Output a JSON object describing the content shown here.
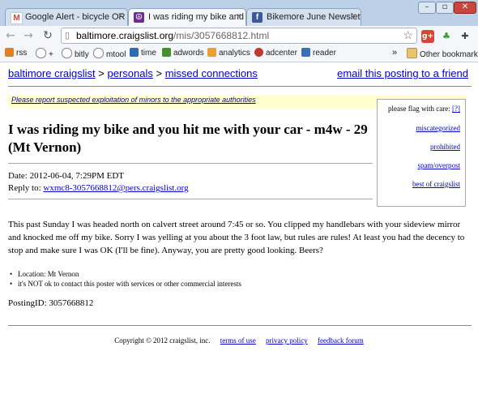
{
  "browser": {
    "tabs": [
      {
        "title": "Google Alert - bicycle OR bike",
        "icon": "gmail-icon",
        "active": false
      },
      {
        "title": "I was riding my bike and you h",
        "icon": "peace-icon",
        "active": true
      },
      {
        "title": "Bikemore June Newsletter",
        "icon": "facebook-icon",
        "active": false
      }
    ],
    "url_host": "baltimore.craigslist.org",
    "url_path": "/mis/3057668812.html",
    "bookmarks": [
      "rss",
      "+",
      "bitly",
      "mtool",
      "time",
      "adwords",
      "analytics",
      "adcenter",
      "reader"
    ],
    "other_bookmarks": "Other bookmarks",
    "overflow": "»"
  },
  "page": {
    "breadcrumb": {
      "home": "baltimore craigslist",
      "sep1": ">",
      "section": "personals",
      "sep2": ">",
      "sub": "missed connections"
    },
    "email_link": "email this posting to a friend",
    "warning": "Please report suspected exploitation of minors to the appropriate authorities",
    "flag": {
      "header": "please flag with care:",
      "help": "[?]",
      "options": [
        "miscategorized",
        "prohibited",
        "spam/overpost",
        "best of craigslist"
      ]
    },
    "title": "I was riding my bike and you hit me with your car - m4w - 29 (Mt Vernon)",
    "date_label": "Date: 2012-06-04, 7:29PM EDT",
    "reply_label": "Reply to:",
    "reply_email": "wxmc8-3057668812@pers.craigslist.org",
    "body": "This past Sunday I was headed north on calvert street around 7:45 or so. You clipped my handlebars with your sideview mirror and knocked me off my bike. Sorry I was yelling at you about the 3 foot law, but rules are rules! At least you had the decency to stop and make sure I was OK (I'll be fine). Anyway, you are pretty good looking. Beers?",
    "info": [
      "Location: Mt Vernon",
      "it's NOT ok to contact this poster with services or other commercial interests"
    ],
    "posting_id": "PostingID: 3057668812",
    "footer": {
      "copyright": "Copyright © 2012 craigslist, inc.",
      "links": [
        "terms of use",
        "privacy policy",
        "feedback forum"
      ]
    }
  }
}
